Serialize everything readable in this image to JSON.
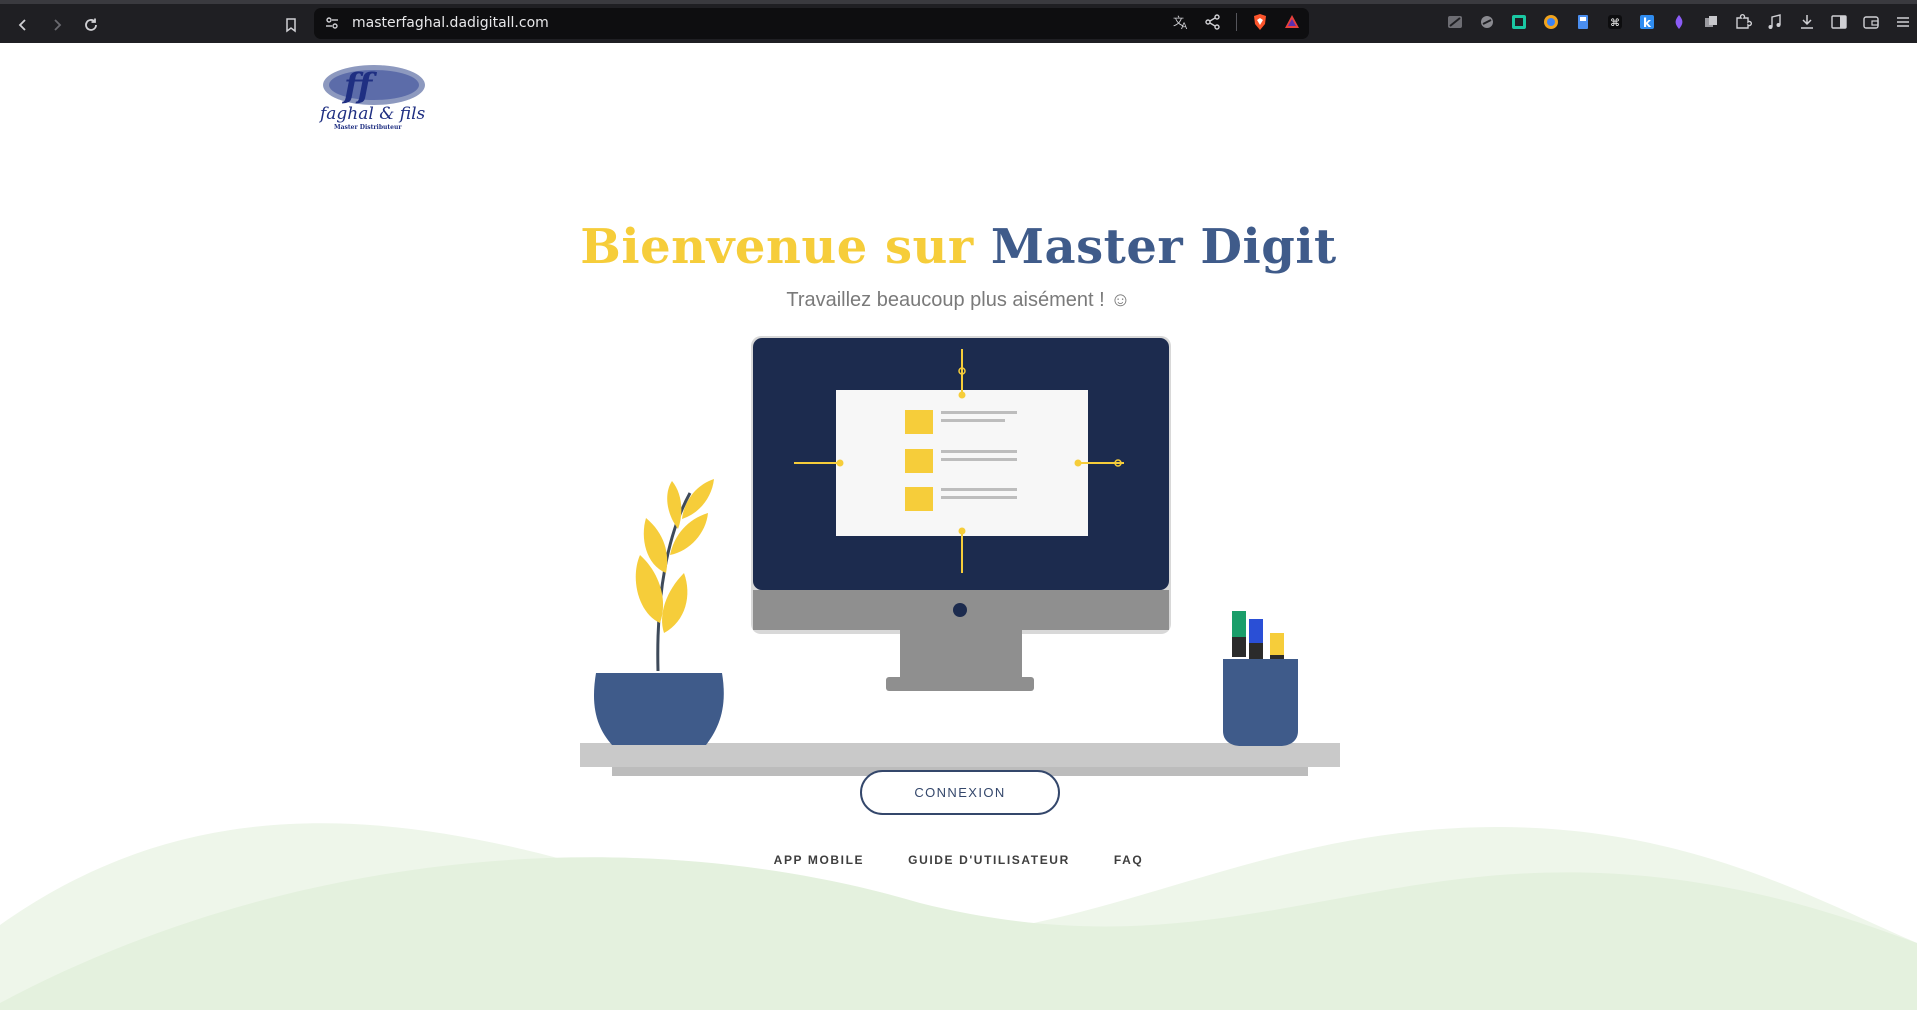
{
  "browser": {
    "url": "masterfaghal.dadigitall.com"
  },
  "logo": {
    "brand": "faghal & fils",
    "tagline": "Master Distributeur",
    "monogram": "ff"
  },
  "hero": {
    "title_part1": "Bienvenue sur",
    "title_part2": "Master Digit",
    "subtitle": "Travaillez beaucoup plus aisément ! ☺"
  },
  "actions": {
    "login_label": "CONNEXION"
  },
  "footer": {
    "links": [
      {
        "label": "APP MOBILE"
      },
      {
        "label": "GUIDE D'UTILISATEUR"
      },
      {
        "label": "FAQ"
      }
    ]
  },
  "colors": {
    "accent_yellow": "#f6cd3a",
    "accent_blue": "#3f5b8a",
    "screen_navy": "#1c2b4e",
    "hill_green": "#e4f1de"
  }
}
